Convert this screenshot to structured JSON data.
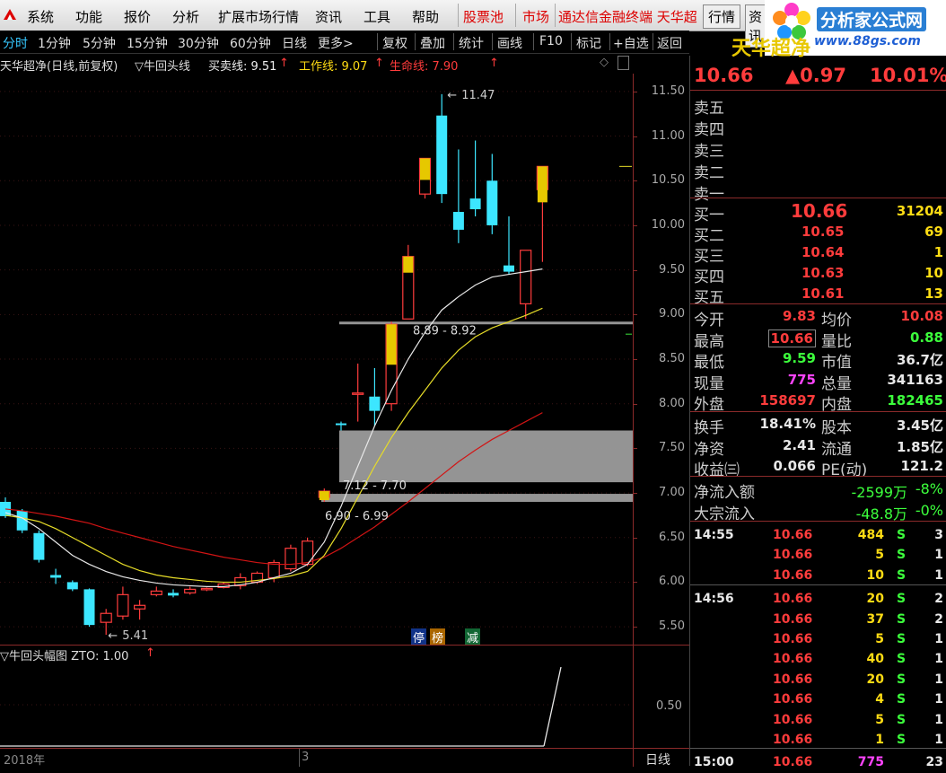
{
  "menubar": {
    "items": [
      "系统",
      "功能",
      "报价",
      "分析",
      "扩展市场行情",
      "资讯",
      "工具",
      "帮助"
    ],
    "red_items": [
      "股票池",
      "市场"
    ],
    "ticker": "通达信金融终端  天华超",
    "btn_quote": "行情",
    "btn_info": "资讯",
    "logo_title": "分析家公式网",
    "logo_url": "www.88gs.com"
  },
  "toolbar": {
    "periods": [
      "分时",
      "1分钟",
      "5分钟",
      "15分钟",
      "30分钟",
      "60分钟",
      "日线",
      "更多>"
    ],
    "tools": [
      "复权",
      "叠加",
      "统计",
      "画线",
      "F10",
      "标记",
      "+自选",
      "返回"
    ]
  },
  "chart": {
    "title": "天华超净(日线,前复权)",
    "indicator": "▽牛回头线",
    "buy_label": "买卖线: 9.51",
    "work_label": "工作线: 9.07",
    "life_label": "生命线: 7.90",
    "y_ticks": [
      "11.50",
      "11.00",
      "10.50",
      "10.00",
      "9.50",
      "9.00",
      "8.50",
      "8.00",
      "7.50",
      "7.00",
      "6.50",
      "6.00",
      "5.50"
    ],
    "annot_high": "11.47",
    "annot_low": "5.41",
    "zone1": "8.89 - 8.92",
    "zone2": "7.12 - 7.70",
    "zone3": "6.90 - 6.99",
    "badges": [
      "停",
      "榜",
      "减"
    ],
    "sub_title": "▽牛回头幅图  ZTO: 1.00",
    "sub_tick": "0.50",
    "x_label_year": "2018年",
    "x_label_month": "3",
    "period_label": "日线",
    "colors": {
      "up": "#ff3c3c",
      "down": "#3ce6ff",
      "white_line": "#e8e8e8",
      "yellow_line": "#e6dc28",
      "red_line": "#d21414",
      "zone": "#9c9c9c"
    }
  },
  "chart_data": {
    "type": "candlestick",
    "ylim": [
      5.3,
      11.7
    ],
    "candles": [
      {
        "o": 6.9,
        "h": 6.95,
        "l": 6.72,
        "c": 6.74
      },
      {
        "o": 6.8,
        "h": 6.82,
        "l": 6.55,
        "c": 6.58
      },
      {
        "o": 6.55,
        "h": 6.58,
        "l": 6.22,
        "c": 6.25
      },
      {
        "o": 6.08,
        "h": 6.15,
        "l": 5.98,
        "c": 6.05
      },
      {
        "o": 6.0,
        "h": 6.02,
        "l": 5.9,
        "c": 5.92
      },
      {
        "o": 5.92,
        "h": 5.93,
        "l": 5.5,
        "c": 5.52
      },
      {
        "o": 5.55,
        "h": 5.7,
        "l": 5.41,
        "c": 5.65
      },
      {
        "o": 5.62,
        "h": 5.95,
        "l": 5.58,
        "c": 5.86
      },
      {
        "o": 5.7,
        "h": 5.8,
        "l": 5.58,
        "c": 5.74
      },
      {
        "o": 5.86,
        "h": 5.95,
        "l": 5.84,
        "c": 5.9
      },
      {
        "o": 5.88,
        "h": 5.92,
        "l": 5.83,
        "c": 5.85
      },
      {
        "o": 5.88,
        "h": 5.95,
        "l": 5.86,
        "c": 5.92
      },
      {
        "o": 5.92,
        "h": 5.94,
        "l": 5.9,
        "c": 5.93
      },
      {
        "o": 5.94,
        "h": 6.0,
        "l": 5.93,
        "c": 5.98
      },
      {
        "o": 5.96,
        "h": 6.1,
        "l": 5.92,
        "c": 6.05
      },
      {
        "o": 6.0,
        "h": 6.12,
        "l": 5.98,
        "c": 6.1
      },
      {
        "o": 6.05,
        "h": 6.25,
        "l": 6.0,
        "c": 6.22
      },
      {
        "o": 6.15,
        "h": 6.42,
        "l": 6.12,
        "c": 6.38
      },
      {
        "o": 6.2,
        "h": 6.5,
        "l": 6.18,
        "c": 6.46
      },
      {
        "o": 6.95,
        "h": 7.05,
        "l": 6.9,
        "c": 7.02
      },
      {
        "o": 7.78,
        "h": 7.8,
        "l": 7.7,
        "c": 7.76
      },
      {
        "o": 8.12,
        "h": 8.45,
        "l": 7.8,
        "c": 8.12
      },
      {
        "o": 8.08,
        "h": 8.4,
        "l": 7.75,
        "c": 7.92
      },
      {
        "o": 8.0,
        "h": 8.92,
        "l": 7.92,
        "c": 8.89
      },
      {
        "o": 8.95,
        "h": 9.78,
        "l": 9.38,
        "c": 9.65
      },
      {
        "o": 10.35,
        "h": 10.75,
        "l": 10.3,
        "c": 10.75
      },
      {
        "o": 11.23,
        "h": 11.47,
        "l": 10.25,
        "c": 10.35
      },
      {
        "o": 10.15,
        "h": 10.85,
        "l": 9.8,
        "c": 9.95
      },
      {
        "o": 10.3,
        "h": 10.95,
        "l": 10.1,
        "c": 10.18
      },
      {
        "o": 10.5,
        "h": 10.8,
        "l": 9.9,
        "c": 10.0
      },
      {
        "o": 9.55,
        "h": 10.1,
        "l": 9.45,
        "c": 9.48
      },
      {
        "o": 9.12,
        "h": 9.72,
        "l": 8.95,
        "c": 9.72
      },
      {
        "o": 10.4,
        "h": 10.66,
        "l": 9.59,
        "c": 10.66
      }
    ],
    "white_line": [
      6.78,
      6.72,
      6.6,
      6.45,
      6.3,
      6.2,
      6.12,
      6.06,
      6.02,
      5.99,
      5.97,
      5.96,
      5.95,
      5.95,
      5.97,
      6.0,
      6.05,
      6.1,
      6.2,
      6.45,
      6.85,
      7.3,
      7.75,
      8.15,
      8.5,
      8.8,
      9.05,
      9.2,
      9.33,
      9.42,
      9.45,
      9.48,
      9.51
    ],
    "yellow_line": [
      6.75,
      6.72,
      6.68,
      6.6,
      6.5,
      6.4,
      6.3,
      6.2,
      6.13,
      6.08,
      6.05,
      6.03,
      6.01,
      6.0,
      6.0,
      6.02,
      6.04,
      6.07,
      6.12,
      6.3,
      6.6,
      6.95,
      7.3,
      7.62,
      7.9,
      8.15,
      8.4,
      8.6,
      8.75,
      8.85,
      8.92,
      8.99,
      9.07
    ],
    "red_line": [
      6.82,
      6.8,
      6.77,
      6.74,
      6.7,
      6.66,
      6.6,
      6.55,
      6.5,
      6.45,
      6.4,
      6.36,
      6.32,
      6.28,
      6.25,
      6.22,
      6.2,
      6.2,
      6.22,
      6.28,
      6.38,
      6.5,
      6.62,
      6.76,
      6.9,
      7.05,
      7.2,
      7.35,
      7.48,
      7.6,
      7.7,
      7.8,
      7.9
    ],
    "zones": [
      {
        "top": 8.92,
        "bottom": 8.89
      },
      {
        "top": 7.7,
        "bottom": 7.12
      },
      {
        "top": 6.99,
        "bottom": 6.9
      }
    ]
  },
  "quote": {
    "name": "天华超净",
    "price": "10.66",
    "change": "▲0.97",
    "pct": "10.01%",
    "sell_labels": [
      "卖五",
      "卖四",
      "卖三",
      "卖二",
      "卖一"
    ],
    "buy": [
      {
        "label": "买一",
        "price": "10.66",
        "vol": "31204"
      },
      {
        "label": "买二",
        "price": "10.65",
        "vol": "69"
      },
      {
        "label": "买三",
        "price": "10.64",
        "vol": "1"
      },
      {
        "label": "买四",
        "price": "10.63",
        "vol": "10"
      },
      {
        "label": "买五",
        "price": "10.61",
        "vol": "13"
      }
    ],
    "stats": [
      {
        "l1": "今开",
        "v1": "9.83",
        "c1": "red",
        "l2": "均价",
        "v2": "10.08",
        "c2": "red"
      },
      {
        "l1": "最高",
        "v1": "10.66",
        "c1": "red",
        "l2": "量比",
        "v2": "0.88",
        "c2": "green"
      },
      {
        "l1": "最低",
        "v1": "9.59",
        "c1": "green",
        "l2": "市值",
        "v2": "36.7亿",
        "c2": "white"
      },
      {
        "l1": "现量",
        "v1": "775",
        "c1": "magenta",
        "l2": "总量",
        "v2": "341163",
        "c2": "white"
      },
      {
        "l1": "外盘",
        "v1": "158697",
        "c1": "red",
        "l2": "内盘",
        "v2": "182465",
        "c2": "green"
      }
    ],
    "stats2": [
      {
        "l1": "换手",
        "v1": "18.41%",
        "l2": "股本",
        "v2": "3.45亿"
      },
      {
        "l1": "净资",
        "v1": "2.41",
        "l2": "流通",
        "v2": "1.85亿"
      },
      {
        "l1": "收益㈢",
        "v1": "0.066",
        "l2": "PE(动)",
        "v2": "121.2"
      }
    ],
    "flow": [
      {
        "label": "净流入额",
        "v": "-2599万",
        "p": "-8%"
      },
      {
        "label": "大宗流入",
        "v": "-48.8万",
        "p": "-0%"
      }
    ],
    "ticks": [
      {
        "t": "14:55",
        "p": "10.66",
        "v": "484",
        "s": "S",
        "n": "3"
      },
      {
        "t": "",
        "p": "10.66",
        "v": "5",
        "s": "S",
        "n": "1"
      },
      {
        "t": "",
        "p": "10.66",
        "v": "10",
        "s": "S",
        "n": "1"
      },
      {
        "t": "14:56",
        "p": "10.66",
        "v": "20",
        "s": "S",
        "n": "2"
      },
      {
        "t": "",
        "p": "10.66",
        "v": "37",
        "s": "S",
        "n": "2"
      },
      {
        "t": "",
        "p": "10.66",
        "v": "5",
        "s": "S",
        "n": "1"
      },
      {
        "t": "",
        "p": "10.66",
        "v": "40",
        "s": "S",
        "n": "1"
      },
      {
        "t": "",
        "p": "10.66",
        "v": "20",
        "s": "S",
        "n": "1"
      },
      {
        "t": "",
        "p": "10.66",
        "v": "4",
        "s": "S",
        "n": "1"
      },
      {
        "t": "",
        "p": "10.66",
        "v": "5",
        "s": "S",
        "n": "1"
      },
      {
        "t": "",
        "p": "10.66",
        "v": "1",
        "s": "S",
        "n": "1"
      },
      {
        "t": "15:00",
        "p": "10.66",
        "v": "775",
        "s": "",
        "n": "23"
      }
    ]
  }
}
